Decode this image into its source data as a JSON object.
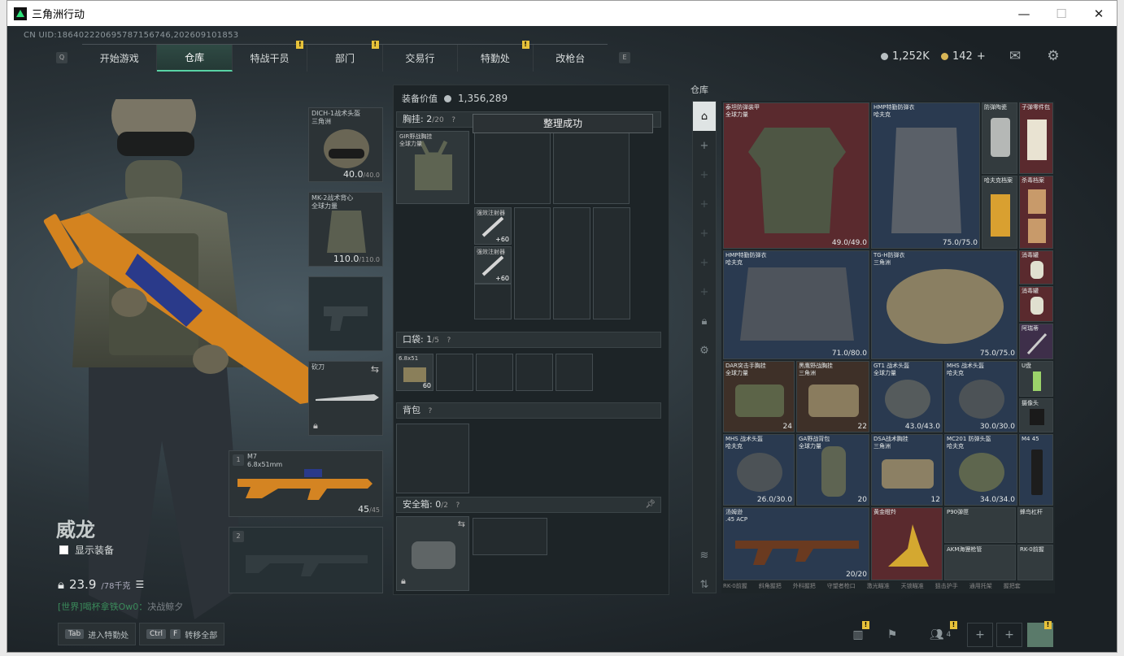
{
  "window": {
    "title": "三角洲行动",
    "minimize": "—",
    "maximize": "☐",
    "close": "✕"
  },
  "uid": "CN UID:1864022206957871567​46,202609101853",
  "nav": {
    "left_key": "Q",
    "right_key": "E",
    "tabs": [
      {
        "label": "开始游戏",
        "badge": ""
      },
      {
        "label": "仓库",
        "badge": ""
      },
      {
        "label": "特战干员",
        "badge": "!"
      },
      {
        "label": "部门",
        "badge": "!"
      },
      {
        "label": "交易行",
        "badge": ""
      },
      {
        "label": "特勤处",
        "badge": "!"
      },
      {
        "label": "改枪台",
        "badge": ""
      }
    ]
  },
  "currency": {
    "silver": "1,252K",
    "gold": "142",
    "plus": "+"
  },
  "icons": {
    "mail": "mail-icon",
    "settings": "gear-icon"
  },
  "player": {
    "name": "威龙",
    "show_equipment": "显示装备",
    "weight": "23.9",
    "weight_max": "/78千克",
    "chat_channel": "[世界]",
    "chat_user": "喝杯拿铁Ow0",
    "chat_msg": "决战鲸夕"
  },
  "bottom": {
    "tab_key": "Tab",
    "tab_label": "进入特勤处",
    "ctrl_key": "Ctrl",
    "f_key": "F",
    "transfer_label": "转移全部",
    "friends_count": "4"
  },
  "equipment": {
    "helmet": {
      "name": "DICH-1战术头盔\n三角洲",
      "dur": "40.0",
      "max": "/40.0"
    },
    "armor": {
      "name": "MK-2战术背心\n全球力量",
      "dur": "110.0",
      "max": "/110.0"
    },
    "melee": {
      "name": "砍刀"
    },
    "primary": {
      "slot": "1",
      "name": "M7",
      "ammo_type": "6.8x51mm",
      "ammo": "45",
      "max": "/45"
    },
    "secondary": {
      "slot": "2"
    }
  },
  "loadout": {
    "value_label": "装备价值",
    "value": "1,356,289",
    "chest_label": "胸挂:",
    "chest_count": "2",
    "chest_max": "/20",
    "chest_item": "GIR野战胸挂\n全球力量",
    "injector_name": "强效注射器",
    "injector_val": "+60",
    "pocket_label": "口袋:",
    "pocket_count": "1",
    "pocket_max": "/5",
    "pocket_item": "6.8x51",
    "pocket_qty": "60",
    "backpack_label": "背包",
    "safe_label": "安全箱:",
    "safe_count": "0",
    "safe_max": "/2",
    "help": "?"
  },
  "toast": "整理成功",
  "storage": {
    "title": "仓库",
    "items": [
      {
        "name": "泰坦防弹装甲\n全球力量",
        "val": "49.0/49.0",
        "color": "#5a2a2e"
      },
      {
        "name": "HMP特勤防弹衣\n哈夫克",
        "val": "75.0/75.0",
        "color": "#2a3a50"
      },
      {
        "name": "防弹陶瓷",
        "val": "",
        "color": "#3a3f44"
      },
      {
        "name": "子弹零件包",
        "val": "",
        "color": "#5a2a2e"
      },
      {
        "name": "哈夫克档案",
        "val": "",
        "color": "#3a3f44"
      },
      {
        "name": "杀毒档案",
        "val": "",
        "color": "#5a2a2e"
      },
      {
        "name": "HMP特勤防弹衣\n哈夫克",
        "val": "71.0/80.0",
        "color": "#2a3a50"
      },
      {
        "name": "TG-H防弹衣\n三角洲",
        "val": "75.0/75.0",
        "color": "#2a3a50"
      },
      {
        "name": "消毒罐",
        "val": "",
        "color": "#5a2a2e"
      },
      {
        "name": "消毒罐",
        "val": "",
        "color": "#5a2a2e"
      },
      {
        "name": "阿瑞蒂",
        "val": "",
        "color": "#3e2f4a"
      },
      {
        "name": "DAR突击手胸挂\n全球力量",
        "val": "24",
        "color": "#3e3028"
      },
      {
        "name": "黑鹰野战胸挂\n三角洲",
        "val": "22",
        "color": "#3e3028"
      },
      {
        "name": "GT1 战术头盔\n全球力量",
        "val": "43.0/43.0",
        "color": "#2a3a50"
      },
      {
        "name": "MHS 战术头盔\n哈夫克",
        "val": "30.0/30.0",
        "color": "#2a3a50"
      },
      {
        "name": "U盘",
        "val": "",
        "color": "#3a3f44"
      },
      {
        "name": "摄像头",
        "val": "",
        "color": "#3a3f44"
      },
      {
        "name": "MHS 战术头盔\n哈夫克",
        "val": "26.0/30.0",
        "color": "#2a3a50"
      },
      {
        "name": "GA野战背包\n全球力量",
        "val": "20",
        "color": "#2a3a50"
      },
      {
        "name": "DSA战术胸挂\n三角洲",
        "val": "12",
        "color": "#2a3a50"
      },
      {
        "name": "MC201 防弹头盔\n哈夫克",
        "val": "34.0/34.0",
        "color": "#2a3a50"
      },
      {
        "name": "M4 45",
        "val": "",
        "color": "#2a3a50"
      },
      {
        "name": "汤姆逊\n.45 ACP",
        "val": "20/20",
        "color": "#2a3a50"
      },
      {
        "name": "黄金瞪羚",
        "val": "",
        "color": "#5a2a2e"
      },
      {
        "name": "P90弹匣",
        "val": "",
        "color": "#333b3e"
      },
      {
        "name": "蜂鸟杠杆",
        "val": "",
        "color": "#333b3e"
      },
      {
        "name": "AKM海狸枪管",
        "val": "",
        "color": "#333b3e"
      },
      {
        "name": "RK-0前握",
        "val": "",
        "color": "#333b3e"
      }
    ],
    "bottom_labels": [
      "RK-0前握",
      "斜角握把",
      "外科握把",
      "守望者枪口",
      "激光瞄准",
      "天锁瞄准",
      "狙击护手",
      "通用托架",
      "握把套"
    ]
  },
  "colors": {
    "accent": "#59d3a5",
    "badge": "#e7c23a"
  }
}
